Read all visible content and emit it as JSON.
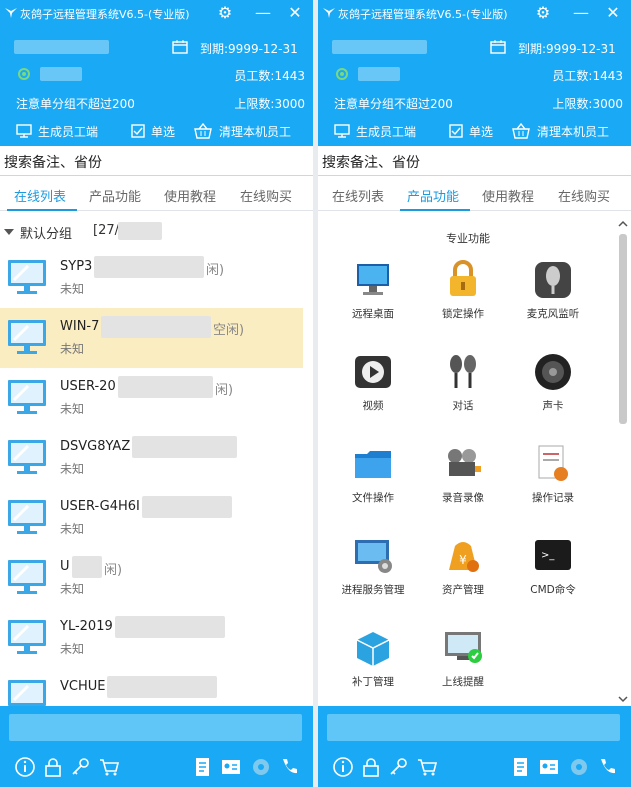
{
  "app": {
    "title": "灰鸽子远程管理系统V6.5-(专业版)",
    "expire": "到期:9999-12-31",
    "employee_count": "员工数:1443",
    "note": "注意单分组不超过200",
    "limit": "上限数:3000"
  },
  "toolbar": {
    "generate_label": "生成员工端",
    "select_label": "单选",
    "clean_label": "清理本机员工"
  },
  "search": {
    "placeholder": "搜索备注、省份"
  },
  "tabs": [
    "在线列表",
    "产品功能",
    "使用教程",
    "在线购买"
  ],
  "group": {
    "label": "默认分组",
    "count": "[27/"
  },
  "devices": [
    {
      "name": "SYP3",
      "suffix": "闲)",
      "status": "未知"
    },
    {
      "name": "WIN-7",
      "suffix": "空闲)",
      "status": "未知"
    },
    {
      "name": "USER-20",
      "suffix": "闲)",
      "status": "未知"
    },
    {
      "name": "DSVG8YAZ",
      "suffix": "",
      "status": "未知"
    },
    {
      "name": "USER-G4H6I",
      "suffix": "",
      "status": "未知"
    },
    {
      "name": "U",
      "suffix": "闲)",
      "status": "未知"
    },
    {
      "name": "YL-2019",
      "suffix": "",
      "status": "未知"
    },
    {
      "name": "VCHUE",
      "suffix": "",
      "status": ""
    }
  ],
  "features": {
    "title": "专业功能",
    "items": [
      {
        "label": "远程桌面",
        "icon": "remote-desktop-icon"
      },
      {
        "label": "锁定操作",
        "icon": "lock-icon"
      },
      {
        "label": "麦克风监听",
        "icon": "microphone-icon"
      },
      {
        "label": "视频",
        "icon": "video-icon"
      },
      {
        "label": "对话",
        "icon": "chat-mic-icon"
      },
      {
        "label": "声卡",
        "icon": "speaker-icon"
      },
      {
        "label": "文件操作",
        "icon": "folder-icon"
      },
      {
        "label": "录音录像",
        "icon": "recorder-icon"
      },
      {
        "label": "操作记录",
        "icon": "log-icon"
      },
      {
        "label": "进程服务管理",
        "icon": "process-icon"
      },
      {
        "label": "资产管理",
        "icon": "assets-icon"
      },
      {
        "label": "CMD命令",
        "icon": "cmd-icon"
      },
      {
        "label": "补丁管理",
        "icon": "patch-icon"
      },
      {
        "label": "上线提醒",
        "icon": "online-alert-icon"
      }
    ]
  },
  "colors": {
    "header": "#1aa9f4",
    "accent": "#1a9be0",
    "selected_row": "#fbedc2"
  }
}
